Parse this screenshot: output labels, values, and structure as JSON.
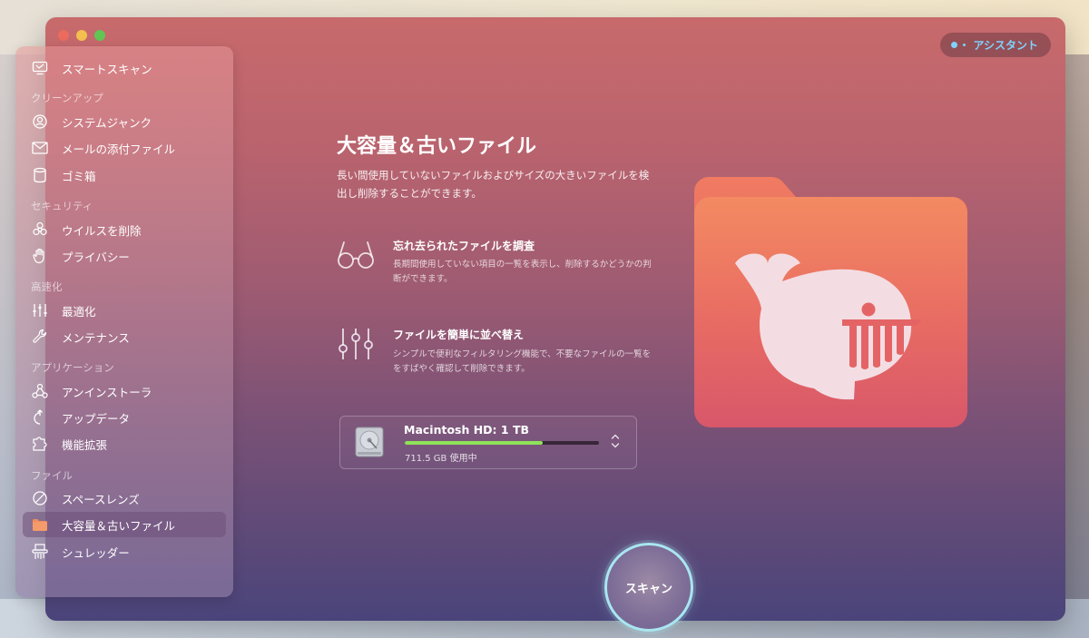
{
  "window": {
    "assistant_label": "アシスタント"
  },
  "sidebar": {
    "top_item": "スマートスキャン",
    "sections": [
      {
        "header": "クリーンアップ",
        "items": [
          "システムジャンク",
          "メールの添付ファイル",
          "ゴミ箱"
        ]
      },
      {
        "header": "セキュリティ",
        "items": [
          "ウイルスを削除",
          "プライバシー"
        ]
      },
      {
        "header": "高速化",
        "items": [
          "最適化",
          "メンテナンス"
        ]
      },
      {
        "header": "アプリケーション",
        "items": [
          "アンインストーラ",
          "アップデータ",
          "機能拡張"
        ]
      },
      {
        "header": "ファイル",
        "items": [
          "スペースレンズ",
          "大容量＆古いファイル",
          "シュレッダー"
        ]
      }
    ],
    "active_item": "大容量＆古いファイル"
  },
  "main": {
    "title": "大容量＆古いファイル",
    "description": "長い間使用していないファイルおよびサイズの大きいファイルを検出し削除することができます。",
    "features": [
      {
        "icon": "glasses-icon",
        "title": "忘れ去られたファイルを調査",
        "desc": "長期間使用していない項目の一覧を表示し、削除するかどうかの判断ができます。"
      },
      {
        "icon": "sliders-icon",
        "title": "ファイルを簡単に並べ替え",
        "desc": "シンプルで便利なフィルタリング機能で、不要なファイルの一覧ををすばやく確認して削除できます。"
      }
    ],
    "disk": {
      "name": "Macintosh HD: 1 TB",
      "used": "711.5 GB 使用中",
      "used_fraction": 0.71
    },
    "scan_label": "スキャン"
  },
  "colors": {
    "accent_green": "#8fe35a",
    "scan_ring": "#a9e6f0",
    "assistant_text": "#7fd3ff",
    "folder_orange": "#f08a5d"
  }
}
